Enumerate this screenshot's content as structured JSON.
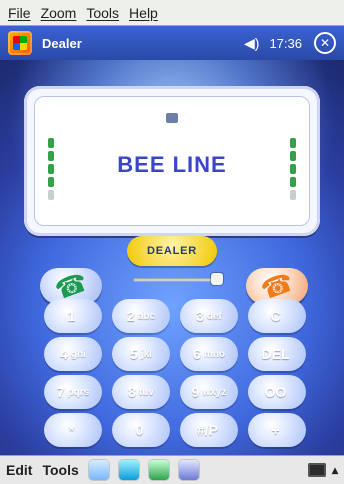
{
  "menu": {
    "items": [
      "File",
      "Zoom",
      "Tools",
      "Help"
    ]
  },
  "titlebar": {
    "app_title": "Dealer",
    "time": "17:36"
  },
  "dialer": {
    "operator": "BEE LINE",
    "dealer_label": "DEALER",
    "keys": [
      {
        "main": "1",
        "sub": ""
      },
      {
        "main": "2",
        "sub": "abc"
      },
      {
        "main": "3",
        "sub": "def"
      },
      {
        "main": "C",
        "sub": ""
      },
      {
        "main": "4",
        "sub": "ghi"
      },
      {
        "main": "5",
        "sub": "jkl"
      },
      {
        "main": "6",
        "sub": "mno"
      },
      {
        "main": "DEL",
        "sub": ""
      },
      {
        "main": "7",
        "sub": "pqrs"
      },
      {
        "main": "8",
        "sub": "tuv"
      },
      {
        "main": "9",
        "sub": "wxyz"
      },
      {
        "main": "OO",
        "sub": ""
      },
      {
        "main": "*",
        "sub": ""
      },
      {
        "main": "0",
        "sub": ""
      },
      {
        "main": "#/P",
        "sub": ""
      },
      {
        "main": "+",
        "sub": ""
      }
    ]
  },
  "taskbar": {
    "edit": "Edit",
    "tools": "Tools"
  },
  "icons": {
    "start": "windows-flag-icon",
    "volume": "speaker-icon",
    "close": "close-icon",
    "call": "phone-handset-icon",
    "end": "hangup-handset-icon",
    "battery": "battery-icon",
    "signal": "signal-icon",
    "keyboard": "keyboard-icon"
  },
  "colors": {
    "title_bar": "#2a4aa7",
    "operator_text": "#3b45c9",
    "dealer_pill": "#f0c700",
    "call": "#1b9b4d",
    "end": "#f07b1a"
  }
}
